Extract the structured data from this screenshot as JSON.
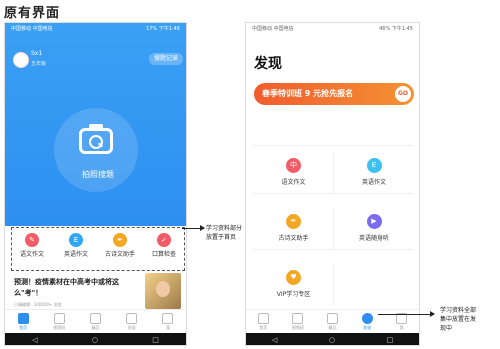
{
  "caption": "原有界面",
  "phone1": {
    "status_left": "中国移动 中国电信",
    "status_right": "17% 下午1:46",
    "user_name": "Sx1",
    "user_grade": "五年级",
    "record_button": "搜题记录",
    "camera_label": "拍照搜题",
    "tools": [
      {
        "label": "语文作文",
        "color": "#f25c66",
        "glyph": "✎"
      },
      {
        "label": "英语作文",
        "color": "#2fa9f5",
        "glyph": "E"
      },
      {
        "label": "古诗文助手",
        "color": "#f3a825",
        "glyph": "✒"
      },
      {
        "label": "口算检查",
        "color": "#f25c66",
        "glyph": "✓"
      }
    ],
    "headline": "预测！疫情素材在中高考中或将这么\"考\"！",
    "meta": "小猿编辑 · 100000+ 浏览",
    "nav": [
      {
        "label": "首页",
        "active": true
      },
      {
        "label": "视频班",
        "active": false
      },
      {
        "label": "精品",
        "active": false
      },
      {
        "label": "发现",
        "active": false
      },
      {
        "label": "我",
        "active": false
      }
    ],
    "sys": [
      "◁",
      "○",
      "□"
    ]
  },
  "phone2": {
    "status_left": "中国移动 中国电信",
    "status_right": "46% 下午1:45",
    "title": "发现",
    "banner_text": "春季特训班 9 元抢先报名",
    "banner_go": "GO",
    "grid": [
      {
        "label": "语文作文",
        "color": "#f25c66",
        "glyph": "中"
      },
      {
        "label": "英语作文",
        "color": "#3cc0f0",
        "glyph": "E"
      },
      {
        "label": "古诗文助手",
        "color": "#f3a825",
        "glyph": "✒"
      },
      {
        "label": "英语随身听",
        "color": "#7a6bf0",
        "glyph": "▶"
      },
      {
        "label": "VIP学习专区",
        "color": "#f3a825",
        "glyph": "♥"
      }
    ],
    "nav": [
      {
        "label": "首页",
        "active": false
      },
      {
        "label": "视频班",
        "active": false
      },
      {
        "label": "精品",
        "active": false
      },
      {
        "label": "发现",
        "active": true
      },
      {
        "label": "我",
        "active": false
      }
    ],
    "sys": [
      "◁",
      "○",
      "□"
    ]
  },
  "annotations": {
    "left_note_line1": "学习资料部分",
    "left_note_line2": "放置于首页",
    "right_note_line1": "学习资料全部",
    "right_note_line2": "集中放置在发",
    "right_note_line3": "现中"
  }
}
